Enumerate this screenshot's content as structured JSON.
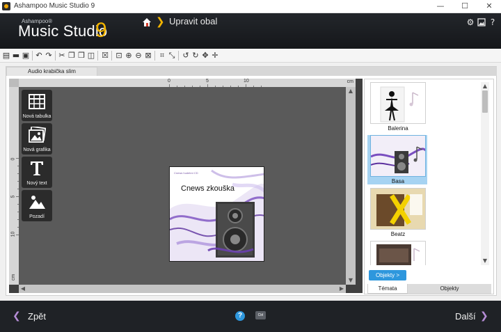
{
  "window": {
    "title": "Ashampoo Music Studio 9",
    "controls": {
      "minimize": "—",
      "maximize": "☐",
      "close": "✕"
    }
  },
  "header": {
    "brand_small": "Ashampoo®",
    "brand_name": "Music Studio",
    "brand_version": "9",
    "breadcrumb": "Upravit obal",
    "icons": [
      "home-icon",
      "chevron-right-icon",
      "gear-icon",
      "picture-icon",
      "help-icon"
    ]
  },
  "toolbar": {
    "icons": [
      "new-icon",
      "open-icon",
      "save-icon",
      "undo-icon",
      "redo-icon",
      "cut-icon",
      "copy-icon",
      "paste-icon",
      "layers-icon",
      "delete-icon",
      "zoom-fit-icon",
      "zoom-in-icon",
      "zoom-out-icon",
      "zoom-selection-icon",
      "crop-icon",
      "resize-icon",
      "rotate-left-icon",
      "rotate-right-icon",
      "move-horizontal-icon",
      "move-icon"
    ]
  },
  "document_tab": "Audio krabička slim",
  "ruler": {
    "unit": "cm",
    "top_labels": [
      "0",
      "5",
      "10"
    ],
    "left_labels": [
      "0",
      "5",
      "10"
    ]
  },
  "tools": [
    {
      "label": "Nová tabulka",
      "icon": "table-icon"
    },
    {
      "label": "Nová grafika",
      "icon": "image-icon"
    },
    {
      "label": "Nový text",
      "icon": "text-icon"
    },
    {
      "label": "Pozadí",
      "icon": "background-icon"
    }
  ],
  "cover": {
    "small_text": "Cnews hudební CD",
    "title": "Cnews zkouška"
  },
  "themes": {
    "items": [
      {
        "label": "Balerina",
        "selected": false
      },
      {
        "label": "Basa",
        "selected": true
      },
      {
        "label": "Beatz",
        "selected": false
      },
      {
        "label": "",
        "selected": false
      }
    ],
    "objects_button": "Objekty >",
    "tabs": [
      "Témata",
      "Objekty"
    ],
    "active_tab": "Témata"
  },
  "footer": {
    "back_label": "Zpět",
    "next_label": "Další",
    "ctrl_label": "Ctrl"
  },
  "colors": {
    "accent_yellow": "#f2b400",
    "accent_blue": "#2e97dd",
    "accent_purple": "#b58cd6",
    "header_bg": "#1c1e22"
  }
}
